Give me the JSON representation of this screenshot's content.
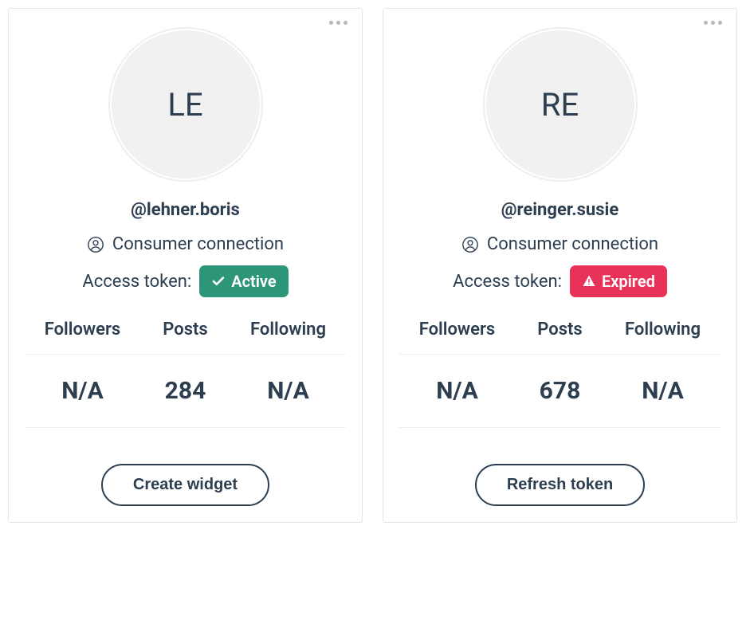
{
  "labels": {
    "connection_type": "Consumer connection",
    "access_token_label": "Access token:",
    "stat_followers": "Followers",
    "stat_posts": "Posts",
    "stat_following": "Following"
  },
  "cards": [
    {
      "avatar_initials": "LE",
      "handle": "@lehner.boris",
      "token_status": "Active",
      "token_status_type": "active",
      "followers": "N/A",
      "posts": "284",
      "following": "N/A",
      "action_label": "Create widget"
    },
    {
      "avatar_initials": "RE",
      "handle": "@reinger.susie",
      "token_status": "Expired",
      "token_status_type": "expired",
      "followers": "N/A",
      "posts": "678",
      "following": "N/A",
      "action_label": "Refresh token"
    }
  ]
}
